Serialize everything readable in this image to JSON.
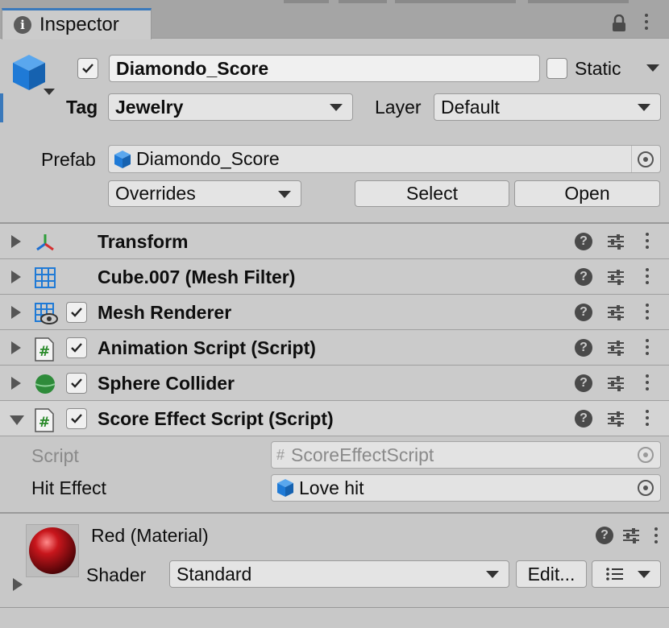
{
  "window": {
    "tab_title": "Inspector",
    "icons": {
      "info": "info-icon",
      "lock": "lock-icon",
      "menu": "kebab-menu-icon"
    }
  },
  "header": {
    "object_icon": "cube-icon",
    "active_checked": true,
    "name": "Diamondo_Score",
    "static_label": "Static",
    "static_checked": false,
    "tag_label": "Tag",
    "tag_value": "Jewelry",
    "layer_label": "Layer",
    "layer_value": "Default",
    "prefab_label": "Prefab",
    "prefab_value": "Diamondo_Score",
    "overrides_label": "Overrides",
    "select_label": "Select",
    "open_label": "Open"
  },
  "components": [
    {
      "title": "Transform",
      "icon": "transform-icon",
      "has_checkbox": false,
      "expanded": false
    },
    {
      "title": "Cube.007 (Mesh Filter)",
      "icon": "mesh-filter-icon",
      "has_checkbox": false,
      "expanded": false
    },
    {
      "title": "Mesh Renderer",
      "icon": "mesh-renderer-icon",
      "has_checkbox": true,
      "checked": true,
      "expanded": false
    },
    {
      "title": "Animation Script (Script)",
      "icon": "script-icon",
      "has_checkbox": true,
      "checked": true,
      "expanded": false
    },
    {
      "title": "Sphere Collider",
      "icon": "sphere-collider-icon",
      "has_checkbox": true,
      "checked": true,
      "expanded": false
    },
    {
      "title": "Score Effect Script (Script)",
      "icon": "script-icon",
      "has_checkbox": true,
      "checked": true,
      "expanded": true
    }
  ],
  "score_effect_fields": {
    "script_label": "Script",
    "script_value": "ScoreEffectScript",
    "hit_effect_label": "Hit Effect",
    "hit_effect_value": "Love hit"
  },
  "material": {
    "title": "Red (Material)",
    "shader_label": "Shader",
    "shader_value": "Standard",
    "edit_label": "Edit...",
    "preview_color": "#c0161c"
  },
  "colors": {
    "accent": "#3a79bb",
    "panel": "#cbcbcb",
    "cube_blue": "#1f7ad6",
    "script_green": "#2a8a2a"
  }
}
